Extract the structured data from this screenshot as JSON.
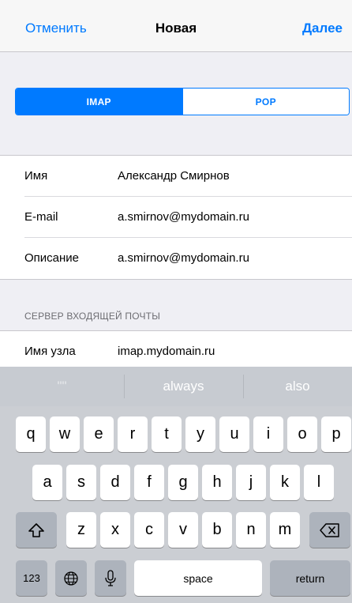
{
  "navbar": {
    "cancel_label": "Отменить",
    "title": "Новая",
    "next_label": "Далее"
  },
  "segmented": {
    "options": [
      "IMAP",
      "POP"
    ],
    "selected": "IMAP"
  },
  "account_form": {
    "rows": [
      {
        "label": "Имя",
        "value": "Александр Смирнов"
      },
      {
        "label": "E-mail",
        "value": "a.smirnov@mydomain.ru"
      },
      {
        "label": "Описание",
        "value": "a.smirnov@mydomain.ru"
      }
    ]
  },
  "incoming_server": {
    "header": "СЕРВЕР ВХОДЯЩЕЙ ПОЧТЫ",
    "host_label": "Имя узла",
    "host_value": "imap.mydomain.ru"
  },
  "keyboard": {
    "suggestions": [
      "\"\"",
      "always",
      "also"
    ],
    "row1": [
      "q",
      "w",
      "e",
      "r",
      "t",
      "y",
      "u",
      "i",
      "o",
      "p"
    ],
    "row2": [
      "a",
      "s",
      "d",
      "f",
      "g",
      "h",
      "j",
      "k",
      "l"
    ],
    "row3": [
      "z",
      "x",
      "c",
      "v",
      "b",
      "n",
      "m"
    ],
    "bottom": {
      "numbers_label": "123",
      "space_label": "space",
      "return_label": "return"
    },
    "icons": {
      "shift": "shift-icon",
      "delete": "delete-icon",
      "globe": "globe-icon",
      "mic": "microphone-icon"
    }
  },
  "colors": {
    "accent": "#007aff",
    "background": "#efeff4",
    "keyboard_bg": "#cbced3"
  }
}
